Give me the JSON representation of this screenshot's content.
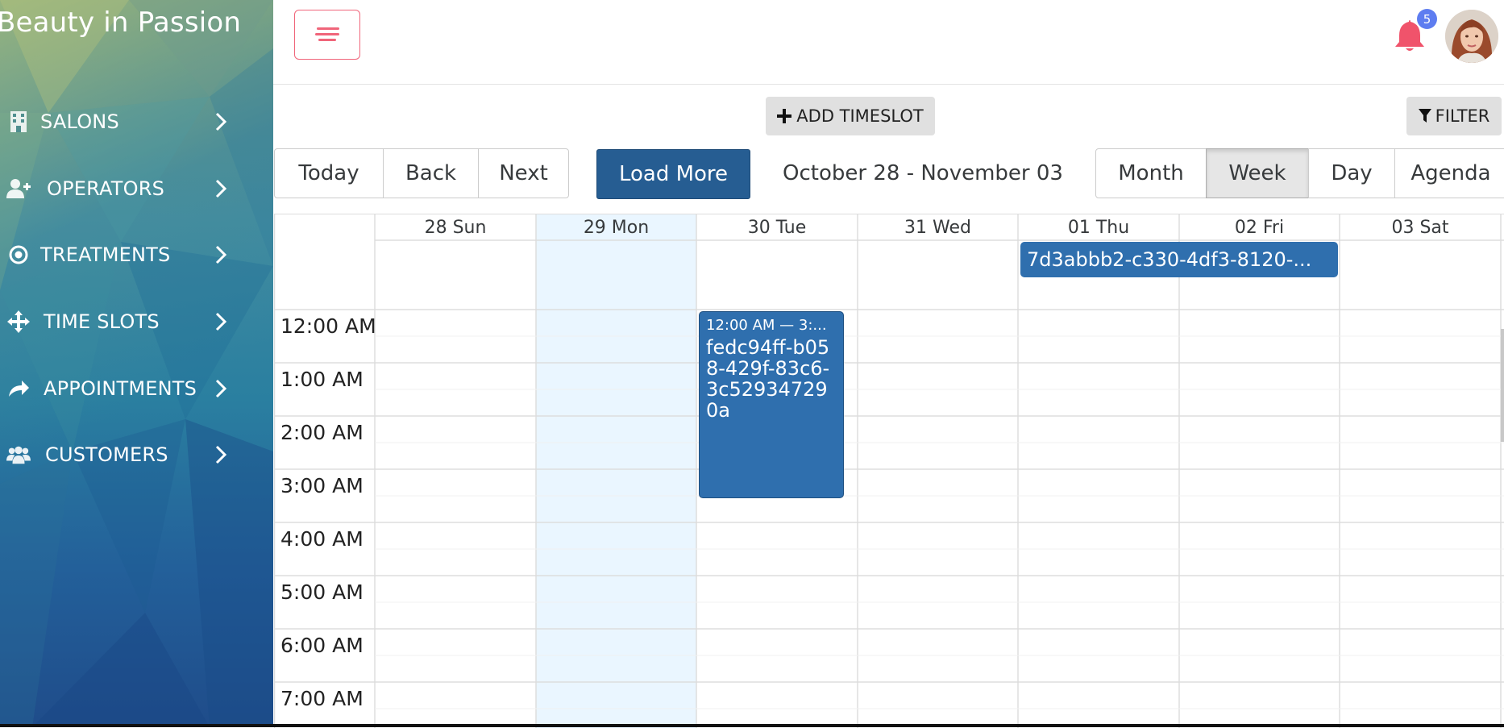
{
  "brand": {
    "title": "Beauty in Passion"
  },
  "sidebar": {
    "items": [
      {
        "label": "SALONS",
        "icon": "building-icon"
      },
      {
        "label": "OPERATORS",
        "icon": "user-plus-icon"
      },
      {
        "label": "TREATMENTS",
        "icon": "dot-circle-icon"
      },
      {
        "label": "TIME SLOTS",
        "icon": "arrows-move-icon"
      },
      {
        "label": "APPOINTMENTS",
        "icon": "share-arrow-icon"
      },
      {
        "label": "CUSTOMERS",
        "icon": "users-icon"
      }
    ]
  },
  "header": {
    "notifications_count": "5",
    "menu_icon": "menu-lines-icon",
    "accent_color": "#f0657a"
  },
  "actions": {
    "add_timeslot": "ADD TIMESLOT",
    "filter": "FILTER"
  },
  "toolbar": {
    "today": "Today",
    "back": "Back",
    "next": "Next",
    "load_more": "Load More",
    "range": "October 28 - November 03",
    "views": {
      "month": "Month",
      "week": "Week",
      "day": "Day",
      "agenda": "Agenda"
    },
    "active_view": "Week"
  },
  "calendar": {
    "days": [
      "28 Sun",
      "29 Mon",
      "30 Tue",
      "31 Wed",
      "01 Thu",
      "02 Fri",
      "03 Sat"
    ],
    "today": "29 Mon",
    "times": [
      "12:00 AM",
      "1:00 AM",
      "2:00 AM",
      "3:00 AM",
      "4:00 AM",
      "5:00 AM",
      "6:00 AM",
      "7:00 AM"
    ],
    "allday_event": {
      "title": "7d3abbb2-c330-4df3-8120-...",
      "days": "01 Thu – 02 Fri"
    },
    "timed_event": {
      "time": "12:00 AM — 3:...",
      "title": "fedc94ff-b058-429f-83c6-3c529347290a",
      "day": "30 Tue"
    },
    "event_color": "#2f6fae"
  }
}
